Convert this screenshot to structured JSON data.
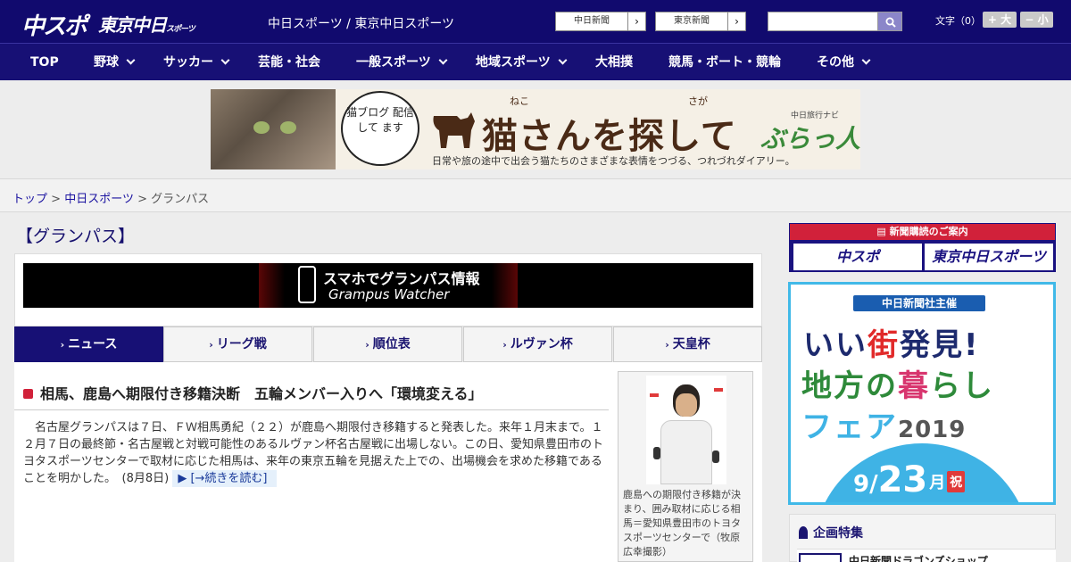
{
  "header": {
    "logo_main": "中スポ",
    "logo_sub": "東京中日",
    "logo_sub_small": "スポーツ",
    "site_title": "中日スポーツ / 東京中日スポーツ",
    "ext_links": [
      "中日新聞",
      "東京新聞"
    ],
    "search_placeholder": "",
    "font_size_label": "文字（0）",
    "font_larger": "+ 大",
    "font_smaller": "− 小"
  },
  "nav": {
    "items": [
      {
        "label": "TOP",
        "dropdown": false
      },
      {
        "label": "野球",
        "dropdown": true
      },
      {
        "label": "サッカー",
        "dropdown": true
      },
      {
        "label": "芸能・社会",
        "dropdown": false
      },
      {
        "label": "一般スポーツ",
        "dropdown": true
      },
      {
        "label": "地域スポーツ",
        "dropdown": true
      },
      {
        "label": "大相撲",
        "dropdown": false
      },
      {
        "label": "競馬・ボート・競輪",
        "dropdown": false
      },
      {
        "label": "その他",
        "dropdown": true
      }
    ]
  },
  "ad_banner": {
    "bubble": "猫ブログ 配信して ます",
    "title": "猫さんを探して",
    "ruby_1": "ねこ",
    "ruby_2": "さが",
    "subtitle": "日常や旅の途中で出会う猫たちのさまざまな表情をつづる、つれづれダイアリー。",
    "brand_small": "中日旅行ナビ",
    "brand": "ぶらっ人"
  },
  "breadcrumb": {
    "items": [
      "トップ",
      "中日スポーツ"
    ],
    "separator": ">",
    "current": "グランパス"
  },
  "section_title": "【グランパス】",
  "app_banner": {
    "line1": "スマホでグランパス情報",
    "line2": "Grampus Watcher"
  },
  "tabs": [
    {
      "label": "ニュース",
      "active": true
    },
    {
      "label": "リーグ戦",
      "active": false
    },
    {
      "label": "順位表",
      "active": false
    },
    {
      "label": "ルヴァン杯",
      "active": false
    },
    {
      "label": "天皇杯",
      "active": false
    }
  ],
  "article": {
    "headline": "相馬、鹿島へ期限付き移籍決断　五輪メンバー入りへ「環境変える」",
    "body": "　名古屋グランパスは７日、ＦＷ相馬勇紀（２２）が鹿島へ期限付き移籍すると発表した。来年１月末まで。１２月７日の最終節・名古屋戦と対戦可能性のあるルヴァン杯名古屋戦に出場しない。この日、愛知県豊田市のトヨタスポーツセンターで取材に応じた相馬は、来年の東京五輪を見据えた上での、出場機会を求めた移籍であることを明かした。　(8月8日) ",
    "read_more": "[→続きを読む]",
    "photo_caption": "鹿島への期限付き移籍が決まり、囲み取材に応じる相馬＝愛知県豊田市のトヨタスポーツセンターで（牧原広幸撮影）"
  },
  "sidebar": {
    "subscribe_header": "新聞購読のご案内",
    "subscribe_buttons": [
      "中スポ",
      "東京中日スポーツ"
    ],
    "fair": {
      "organizer": "中日新聞社主催",
      "line1_a": "いい",
      "line1_b": "街",
      "line1_c": "発見!",
      "line2_a": "地方の",
      "line2_b": "暮",
      "line2_c": "らし",
      "line3": "フェア",
      "year": "2019",
      "date_month": "9/",
      "date_day": "23",
      "weekday": "月",
      "holiday": "祝"
    },
    "special_title": "企画特集",
    "special_item": "中日新聞ドラゴンズショップ"
  },
  "colors": {
    "header_bg": "#110a6e",
    "nav_bg": "#171075",
    "accent_red": "#d1213a",
    "fair_blue": "#41b9e8"
  }
}
